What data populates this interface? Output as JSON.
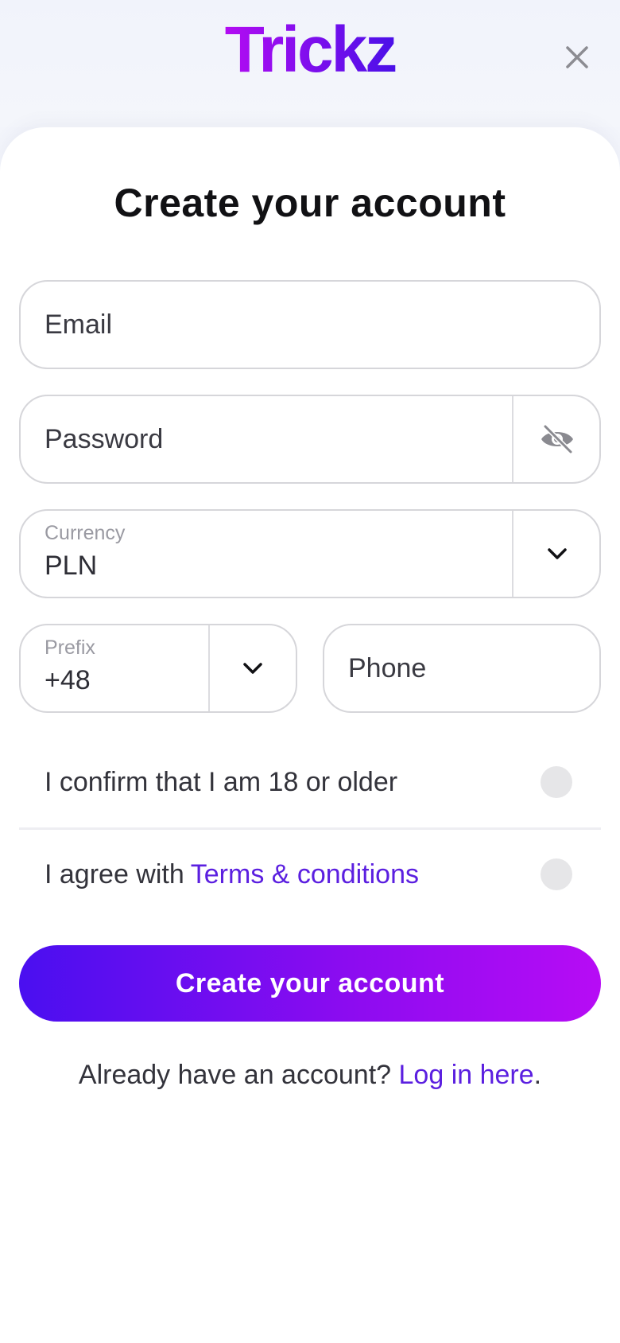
{
  "header": {
    "logo_text": "Trickz",
    "close_icon": "close-icon",
    "logo_colors": [
      "#b30cf2",
      "#4a10e8"
    ]
  },
  "form": {
    "title": "Create your account",
    "email": {
      "placeholder": "Email"
    },
    "password": {
      "placeholder": "Password",
      "icon": "eye-slash-icon"
    },
    "currency": {
      "label": "Currency",
      "value": "PLN",
      "icon": "chevron-down-icon"
    },
    "prefix": {
      "label": "Prefix",
      "value": "+48",
      "icon": "chevron-down-icon"
    },
    "phone": {
      "placeholder": "Phone"
    },
    "age_confirm": {
      "label": "I confirm that I am 18 or older",
      "checked": false
    },
    "terms": {
      "label": "I agree with",
      "link": "Terms & conditions",
      "checked": false
    },
    "submit_label": "Create your account",
    "login_prompt": "Already have an account?",
    "login_link": "Log in here",
    "login_suffix": "."
  },
  "colors": {
    "accent": "#5b1fe0",
    "button_gradient": [
      "#4a0ff0",
      "#b70cf5"
    ]
  }
}
